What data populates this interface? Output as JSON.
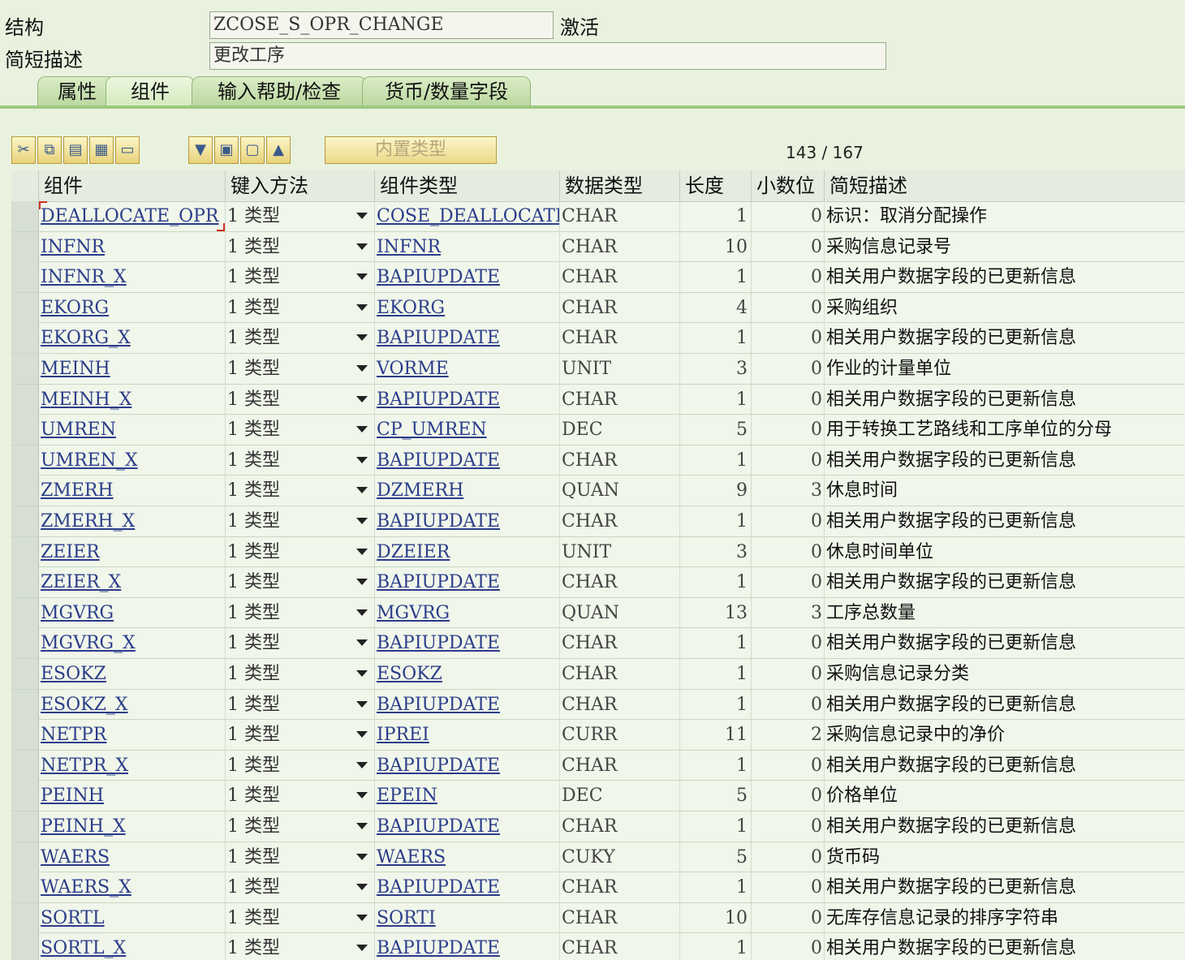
{
  "header": {
    "structure_label": "结构",
    "structure_value": "ZCOSE_S_OPR_CHANGE",
    "status": "激活",
    "desc_label": "简短描述",
    "desc_value": "更改工序"
  },
  "tabs": [
    {
      "label": "属性"
    },
    {
      "label": "组件"
    },
    {
      "label": "输入帮助/检查"
    },
    {
      "label": "货币/数量字段"
    }
  ],
  "toolbar": {
    "builtin_type_label": "内置类型",
    "counter": "143 / 167"
  },
  "table": {
    "columns": [
      "组件",
      "键入方法",
      "组件类型",
      "数据类型",
      "长度",
      "小数位",
      "简短描述"
    ],
    "rows": [
      {
        "comp": "DEALLOCATE_OPR",
        "method": "1 类型",
        "type": "COSE_DEALLOCATE",
        "dtype": "CHAR",
        "len": "1",
        "dec": "0",
        "desc": "标识：取消分配操作"
      },
      {
        "comp": "INFNR",
        "method": "1 类型",
        "type": "INFNR",
        "dtype": "CHAR",
        "len": "10",
        "dec": "0",
        "desc": "采购信息记录号"
      },
      {
        "comp": "INFNR_X",
        "method": "1 类型",
        "type": "BAPIUPDATE",
        "dtype": "CHAR",
        "len": "1",
        "dec": "0",
        "desc": "相关用户数据字段的已更新信息"
      },
      {
        "comp": "EKORG",
        "method": "1 类型",
        "type": "EKORG",
        "dtype": "CHAR",
        "len": "4",
        "dec": "0",
        "desc": "采购组织"
      },
      {
        "comp": "EKORG_X",
        "method": "1 类型",
        "type": "BAPIUPDATE",
        "dtype": "CHAR",
        "len": "1",
        "dec": "0",
        "desc": "相关用户数据字段的已更新信息"
      },
      {
        "comp": "MEINH",
        "method": "1 类型",
        "type": "VORME",
        "dtype": "UNIT",
        "len": "3",
        "dec": "0",
        "desc": "作业的计量单位"
      },
      {
        "comp": "MEINH_X",
        "method": "1 类型",
        "type": "BAPIUPDATE",
        "dtype": "CHAR",
        "len": "1",
        "dec": "0",
        "desc": "相关用户数据字段的已更新信息"
      },
      {
        "comp": "UMREN",
        "method": "1 类型",
        "type": "CP_UMREN",
        "dtype": "DEC",
        "len": "5",
        "dec": "0",
        "desc": "用于转换工艺路线和工序单位的分母"
      },
      {
        "comp": "UMREN_X",
        "method": "1 类型",
        "type": "BAPIUPDATE",
        "dtype": "CHAR",
        "len": "1",
        "dec": "0",
        "desc": "相关用户数据字段的已更新信息"
      },
      {
        "comp": "ZMERH",
        "method": "1 类型",
        "type": "DZMERH",
        "dtype": "QUAN",
        "len": "9",
        "dec": "3",
        "desc": "休息时间"
      },
      {
        "comp": "ZMERH_X",
        "method": "1 类型",
        "type": "BAPIUPDATE",
        "dtype": "CHAR",
        "len": "1",
        "dec": "0",
        "desc": "相关用户数据字段的已更新信息"
      },
      {
        "comp": "ZEIER",
        "method": "1 类型",
        "type": "DZEIER",
        "dtype": "UNIT",
        "len": "3",
        "dec": "0",
        "desc": "休息时间单位"
      },
      {
        "comp": "ZEIER_X",
        "method": "1 类型",
        "type": "BAPIUPDATE",
        "dtype": "CHAR",
        "len": "1",
        "dec": "0",
        "desc": "相关用户数据字段的已更新信息"
      },
      {
        "comp": "MGVRG",
        "method": "1 类型",
        "type": "MGVRG",
        "dtype": "QUAN",
        "len": "13",
        "dec": "3",
        "desc": "工序总数量"
      },
      {
        "comp": "MGVRG_X",
        "method": "1 类型",
        "type": "BAPIUPDATE",
        "dtype": "CHAR",
        "len": "1",
        "dec": "0",
        "desc": "相关用户数据字段的已更新信息"
      },
      {
        "comp": "ESOKZ",
        "method": "1 类型",
        "type": "ESOKZ",
        "dtype": "CHAR",
        "len": "1",
        "dec": "0",
        "desc": "采购信息记录分类"
      },
      {
        "comp": "ESOKZ_X",
        "method": "1 类型",
        "type": "BAPIUPDATE",
        "dtype": "CHAR",
        "len": "1",
        "dec": "0",
        "desc": "相关用户数据字段的已更新信息"
      },
      {
        "comp": "NETPR",
        "method": "1 类型",
        "type": "IPREI",
        "dtype": "CURR",
        "len": "11",
        "dec": "2",
        "desc": "采购信息记录中的净价"
      },
      {
        "comp": "NETPR_X",
        "method": "1 类型",
        "type": "BAPIUPDATE",
        "dtype": "CHAR",
        "len": "1",
        "dec": "0",
        "desc": "相关用户数据字段的已更新信息"
      },
      {
        "comp": "PEINH",
        "method": "1 类型",
        "type": "EPEIN",
        "dtype": "DEC",
        "len": "5",
        "dec": "0",
        "desc": "价格单位"
      },
      {
        "comp": "PEINH_X",
        "method": "1 类型",
        "type": "BAPIUPDATE",
        "dtype": "CHAR",
        "len": "1",
        "dec": "0",
        "desc": "相关用户数据字段的已更新信息"
      },
      {
        "comp": "WAERS",
        "method": "1 类型",
        "type": "WAERS",
        "dtype": "CUKY",
        "len": "5",
        "dec": "0",
        "desc": "货币码"
      },
      {
        "comp": "WAERS_X",
        "method": "1 类型",
        "type": "BAPIUPDATE",
        "dtype": "CHAR",
        "len": "1",
        "dec": "0",
        "desc": "相关用户数据字段的已更新信息"
      },
      {
        "comp": "SORTL",
        "method": "1 类型",
        "type": "SORTI",
        "dtype": "CHAR",
        "len": "10",
        "dec": "0",
        "desc": "无库存信息记录的排序字符串"
      },
      {
        "comp": "SORTL_X",
        "method": "1 类型",
        "type": "BAPIUPDATE",
        "dtype": "CHAR",
        "len": "1",
        "dec": "0",
        "desc": "相关用户数据字段的已更新信息"
      }
    ]
  }
}
